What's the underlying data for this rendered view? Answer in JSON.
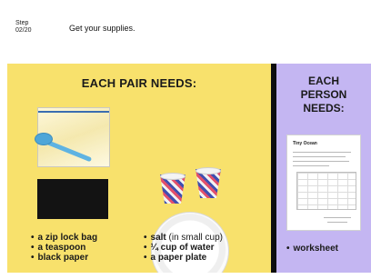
{
  "header": {
    "step_label": "Step",
    "step_count": "02/20",
    "title": "Get your supplies."
  },
  "pair": {
    "heading": "EACH PAIR NEEDS:",
    "items_left": [
      "a zip lock bag",
      "a teaspoon",
      "black paper"
    ],
    "items_right": [
      {
        "text": "salt",
        "note": "(in small cup)"
      },
      {
        "text": "¼ cup of water",
        "note": ""
      },
      {
        "text": "a paper plate",
        "note": ""
      }
    ]
  },
  "person": {
    "heading": [
      "EACH",
      "PERSON",
      "NEEDS:"
    ],
    "items": [
      "worksheet"
    ]
  },
  "worksheet": {
    "title": "Tiny Ocean"
  },
  "colors": {
    "pair_panel": "#f8e16c",
    "person_panel": "#c4b6f2",
    "divider": "#0d0d0d"
  },
  "icons": {
    "bag": "zip-lock-bag-image",
    "spoon": "teaspoon-image",
    "paper": "black-paper-image",
    "cups": "salt-cup-image",
    "plate": "paper-plate-image",
    "sheet": "worksheet-image"
  }
}
